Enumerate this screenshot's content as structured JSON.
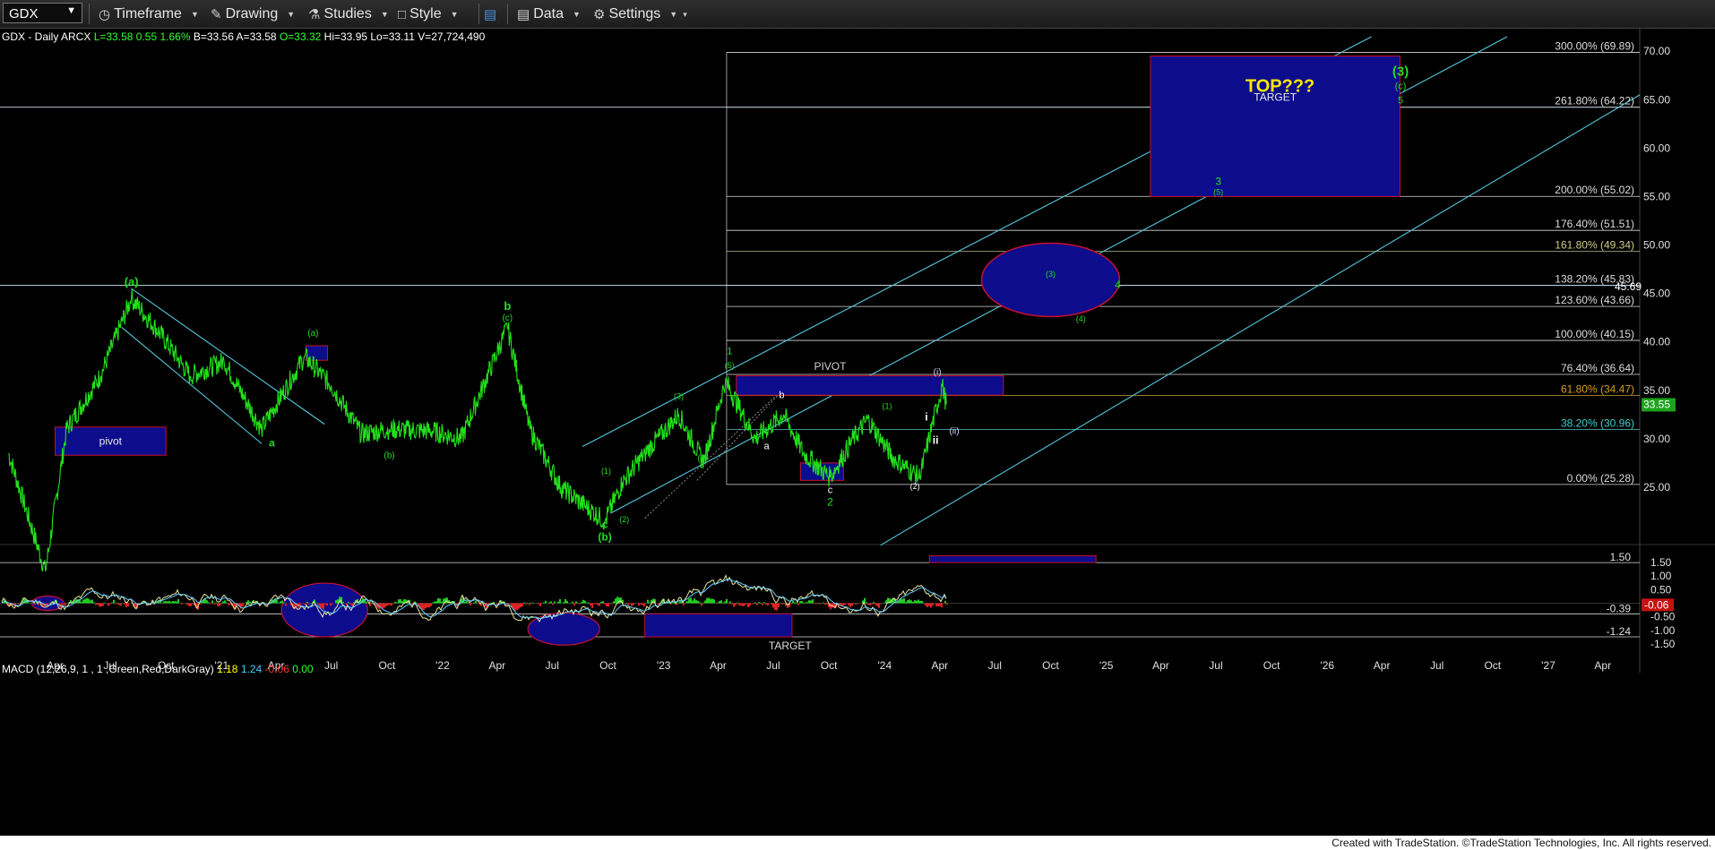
{
  "toolbar": {
    "symbol": "GDX",
    "buttons": [
      {
        "label": "Timeframe",
        "icon": "clock-icon"
      },
      {
        "label": "Drawing",
        "icon": "pencil-icon"
      },
      {
        "label": "Studies",
        "icon": "flask-icon"
      },
      {
        "label": "Style",
        "icon": "style-icon"
      },
      {
        "label": "",
        "icon": "layout-icon"
      },
      {
        "label": "Data",
        "icon": "bar-chart-icon"
      },
      {
        "label": "Settings",
        "icon": "gear-icon"
      }
    ]
  },
  "legend": {
    "symbol_line": "GDX - Daily  ARCX",
    "last": "L=33.58",
    "change": "0.55",
    "change_pct": "1.66%",
    "rest": "B=33.56  A=33.58",
    "open": "O=33.32",
    "hi_lo_vol": "Hi=33.95  Lo=33.11  V=27,724,490"
  },
  "macd_legend": {
    "label": "MACD (12,26,9, 1 , 1 ,Green,Red,DarkGray)",
    "v1": "1.18",
    "v2": "1.24",
    "v3": "-0.06",
    "v4": "0.00"
  },
  "footer": "Created with TradeStation. ©TradeStation Technologies, Inc. All rights reserved.",
  "colors": {
    "price": "#22e01a",
    "fib": "#d8d8d8",
    "channel": "#55c8dd",
    "box": "#0c0c8c",
    "box_border": "#c8102e",
    "wave": "#22dd22",
    "price_tag": "#1ca21c"
  },
  "chart_data": {
    "type": "line",
    "price": {
      "x": [
        "2020-01-15",
        "2020-03-16",
        "2020-04-20",
        "2020-06-15",
        "2020-08-05",
        "2020-09-20",
        "2020-11-10",
        "2021-01-05",
        "2021-03-08",
        "2021-05-18",
        "2021-07-01",
        "2021-08-20",
        "2021-10-05",
        "2021-12-15",
        "2022-02-01",
        "2022-04-18",
        "2022-05-25",
        "2022-07-15",
        "2022-09-26",
        "2022-10-25",
        "2022-12-01",
        "2023-01-26",
        "2023-03-08",
        "2023-04-13",
        "2023-06-01",
        "2023-07-18",
        "2023-08-20",
        "2023-10-03",
        "2023-11-10",
        "2023-12-04",
        "2024-01-15",
        "2024-02-28",
        "2024-03-20",
        "2024-04-05",
        "2024-04-12"
      ],
      "y": [
        28.5,
        16.3,
        31.0,
        36.5,
        44.5,
        41.0,
        36.5,
        38.0,
        31.0,
        38.5,
        35.5,
        30.5,
        31.0,
        30.8,
        30.0,
        41.5,
        31.0,
        25.0,
        21.5,
        25.5,
        28.5,
        32.5,
        27.5,
        36.0,
        30.0,
        32.5,
        28.5,
        26.0,
        30.0,
        32.0,
        28.0,
        26.0,
        31.5,
        35.5,
        33.55
      ]
    },
    "fib_levels": [
      {
        "label": "300.00% (69.89)",
        "value": 69.89
      },
      {
        "label": "261.80% (64.22)",
        "value": 64.22
      },
      {
        "label": "200.00% (55.02)",
        "value": 55.02
      },
      {
        "label": "176.40% (51.51)",
        "value": 51.51
      },
      {
        "label": "161.80% (49.34)",
        "value": 49.34
      },
      {
        "label": "138.20% (45.83)",
        "value": 45.83
      },
      {
        "label": "123.60% (43.66)",
        "value": 43.66
      },
      {
        "label": "100.00% (40.15)",
        "value": 40.15
      },
      {
        "label": "76.40% (36.64)",
        "value": 36.64
      },
      {
        "label": "61.80% (34.47)",
        "value": 34.47
      },
      {
        "label": "38.20% (30.96)",
        "value": 30.96
      },
      {
        "label": "0.00% (25.28)",
        "value": 25.28
      }
    ],
    "price_ticks": [
      70,
      65,
      60,
      55,
      50,
      45,
      40,
      35,
      30,
      25
    ],
    "price_labels": [
      {
        "text": "33.55",
        "value": 33.55
      },
      {
        "text": "45.69",
        "value": 45.69
      }
    ],
    "macd_ticks": [
      1.5,
      1.0,
      0.5,
      0.0,
      -0.5,
      -1.0,
      -1.5
    ],
    "macd_levels": [
      {
        "label": "1.50",
        "value": 1.5
      },
      {
        "label": "-0.39",
        "value": -0.39
      },
      {
        "label": "-1.24",
        "value": -1.24
      }
    ],
    "macd_current": {
      "label": "-0.06",
      "value": -0.06
    },
    "x_labels": [
      "Apr",
      "Jul",
      "Oct",
      "'21",
      "Apr",
      "Jul",
      "Oct",
      "'22",
      "Apr",
      "Jul",
      "Oct",
      "'23",
      "Apr",
      "Jul",
      "Oct",
      "'24",
      "Apr",
      "Jul",
      "Oct",
      "'25",
      "Apr",
      "Jul",
      "Oct",
      "'26",
      "Apr",
      "Jul",
      "Oct",
      "'27",
      "Apr"
    ],
    "boxes": [
      {
        "label": "TARGET",
        "x1": "2025-03-15",
        "x2": "2026-05-01",
        "y1": 69.5,
        "y2": 55.0
      },
      {
        "label": "PIVOT",
        "x1": "2023-05-01",
        "x2": "2024-07-15",
        "y1": 36.5,
        "y2": 34.5
      },
      {
        "label": "pivot",
        "x1": "2020-04-01",
        "x2": "2020-10-01",
        "y1": 31.2,
        "y2": 28.3
      },
      {
        "label": "",
        "x1": "2023-08-15",
        "x2": "2023-10-25",
        "y1": 27.5,
        "y2": 25.7
      },
      {
        "label": "",
        "x1": "2021-05-20",
        "x2": "2021-06-25",
        "y1": 39.6,
        "y2": 38.1
      }
    ],
    "macd_boxes": [
      {
        "label": "",
        "x1": "2024-03-15",
        "x2": "2024-12-15",
        "y1": 1.75,
        "y2": 1.5
      },
      {
        "label": "TARGET",
        "x1": "2022-12-01",
        "x2": "2023-08-01",
        "y1": -0.39,
        "y2": -1.24
      }
    ],
    "annotations": [
      {
        "text": "TOP???",
        "x": "2025-10-15",
        "y": 65.8,
        "color": "#ffe600",
        "size": 20,
        "bold": true
      },
      {
        "text": "(3)",
        "x": "2026-05-02",
        "y": 67.5,
        "color": "#22dd22",
        "size": 15,
        "bold": true
      },
      {
        "text": "(c)",
        "x": "2026-05-02",
        "y": 66.1,
        "color": "#22dd22",
        "size": 11
      },
      {
        "text": "5",
        "x": "2026-05-02",
        "y": 64.6,
        "color": "#22dd22",
        "size": 11
      },
      {
        "text": "3",
        "x": "2025-07-05",
        "y": 56.2,
        "color": "#22dd22",
        "size": 12
      },
      {
        "text": "(5)",
        "x": "2025-07-05",
        "y": 55.2,
        "color": "#22dd22",
        "size": 9
      },
      {
        "text": "(3)",
        "x": "2024-10-01",
        "y": 46.7,
        "color": "#22dd22",
        "size": 9
      },
      {
        "text": "4",
        "x": "2025-01-20",
        "y": 45.5,
        "color": "#22dd22",
        "size": 12
      },
      {
        "text": "(4)",
        "x": "2024-11-20",
        "y": 42.1,
        "color": "#22dd22",
        "size": 9
      },
      {
        "text": "(a)",
        "x": "2020-08-05",
        "y": 45.8,
        "color": "#22dd22",
        "size": 13,
        "bold": true
      },
      {
        "text": "(a)",
        "x": "2021-06-01",
        "y": 40.6,
        "color": "#22dd22",
        "size": 10
      },
      {
        "text": "a",
        "x": "2021-03-25",
        "y": 29.2,
        "color": "#22dd22",
        "size": 12,
        "bold": true
      },
      {
        "text": "b",
        "x": "2022-04-18",
        "y": 43.3,
        "color": "#22dd22",
        "size": 13,
        "bold": true
      },
      {
        "text": "(c)",
        "x": "2022-04-18",
        "y": 42.2,
        "color": "#22dd22",
        "size": 10
      },
      {
        "text": "(b)",
        "x": "2021-10-05",
        "y": 28.0,
        "color": "#22dd22",
        "size": 10
      },
      {
        "text": "c",
        "x": "2022-09-26",
        "y": 20.8,
        "color": "#22dd22",
        "size": 12,
        "bold": true
      },
      {
        "text": "(b)",
        "x": "2022-09-26",
        "y": 19.5,
        "color": "#22dd22",
        "size": 12,
        "bold": true
      },
      {
        "text": "(1)",
        "x": "2022-09-28",
        "y": 26.4,
        "color": "#22dd22",
        "size": 9
      },
      {
        "text": "(2)",
        "x": "2022-10-28",
        "y": 21.4,
        "color": "#22dd22",
        "size": 9
      },
      {
        "text": "(3)",
        "x": "2023-01-26",
        "y": 34.1,
        "color": "#22dd22",
        "size": 9
      },
      {
        "text": "(4)",
        "x": "2023-03-06",
        "y": 27.7,
        "color": "#22dd22",
        "size": 9
      },
      {
        "text": "1",
        "x": "2023-04-20",
        "y": 38.7,
        "color": "#22dd22",
        "size": 11
      },
      {
        "text": "(5)",
        "x": "2023-04-20",
        "y": 37.3,
        "color": "#22dd22",
        "size": 9
      },
      {
        "text": "PIVOT",
        "x": "2023-10-03",
        "y": 37.1,
        "color": "#d0d0d0",
        "size": 12
      },
      {
        "text": "b",
        "x": "2023-07-15",
        "y": 34.2,
        "color": "#ffffff",
        "size": 11
      },
      {
        "text": "a",
        "x": "2023-06-20",
        "y": 28.9,
        "color": "#ffffff",
        "size": 11
      },
      {
        "text": "c",
        "x": "2023-10-03",
        "y": 24.4,
        "color": "#ffffff",
        "size": 11
      },
      {
        "text": "2",
        "x": "2023-10-03",
        "y": 23.1,
        "color": "#22dd22",
        "size": 12
      },
      {
        "text": "(1)",
        "x": "2024-01-05",
        "y": 33.1,
        "color": "#22dd22",
        "size": 9
      },
      {
        "text": "(2)",
        "x": "2024-02-20",
        "y": 24.8,
        "color": "#ffffff",
        "size": 9
      },
      {
        "text": "(i)",
        "x": "2024-03-28",
        "y": 36.6,
        "color": "#d0d0ff",
        "size": 10
      },
      {
        "text": "i",
        "x": "2024-03-10",
        "y": 31.9,
        "color": "#ffffff",
        "size": 12,
        "bold": true
      },
      {
        "text": "(ii)",
        "x": "2024-04-25",
        "y": 30.5,
        "color": "#d0d0ff",
        "size": 10
      },
      {
        "text": "ii",
        "x": "2024-03-25",
        "y": 29.5,
        "color": "#ffffff",
        "size": 12,
        "bold": true
      }
    ],
    "ylim": [
      20,
      71.5
    ],
    "xlim": [
      "2020-01-01",
      "2027-06-01"
    ]
  }
}
